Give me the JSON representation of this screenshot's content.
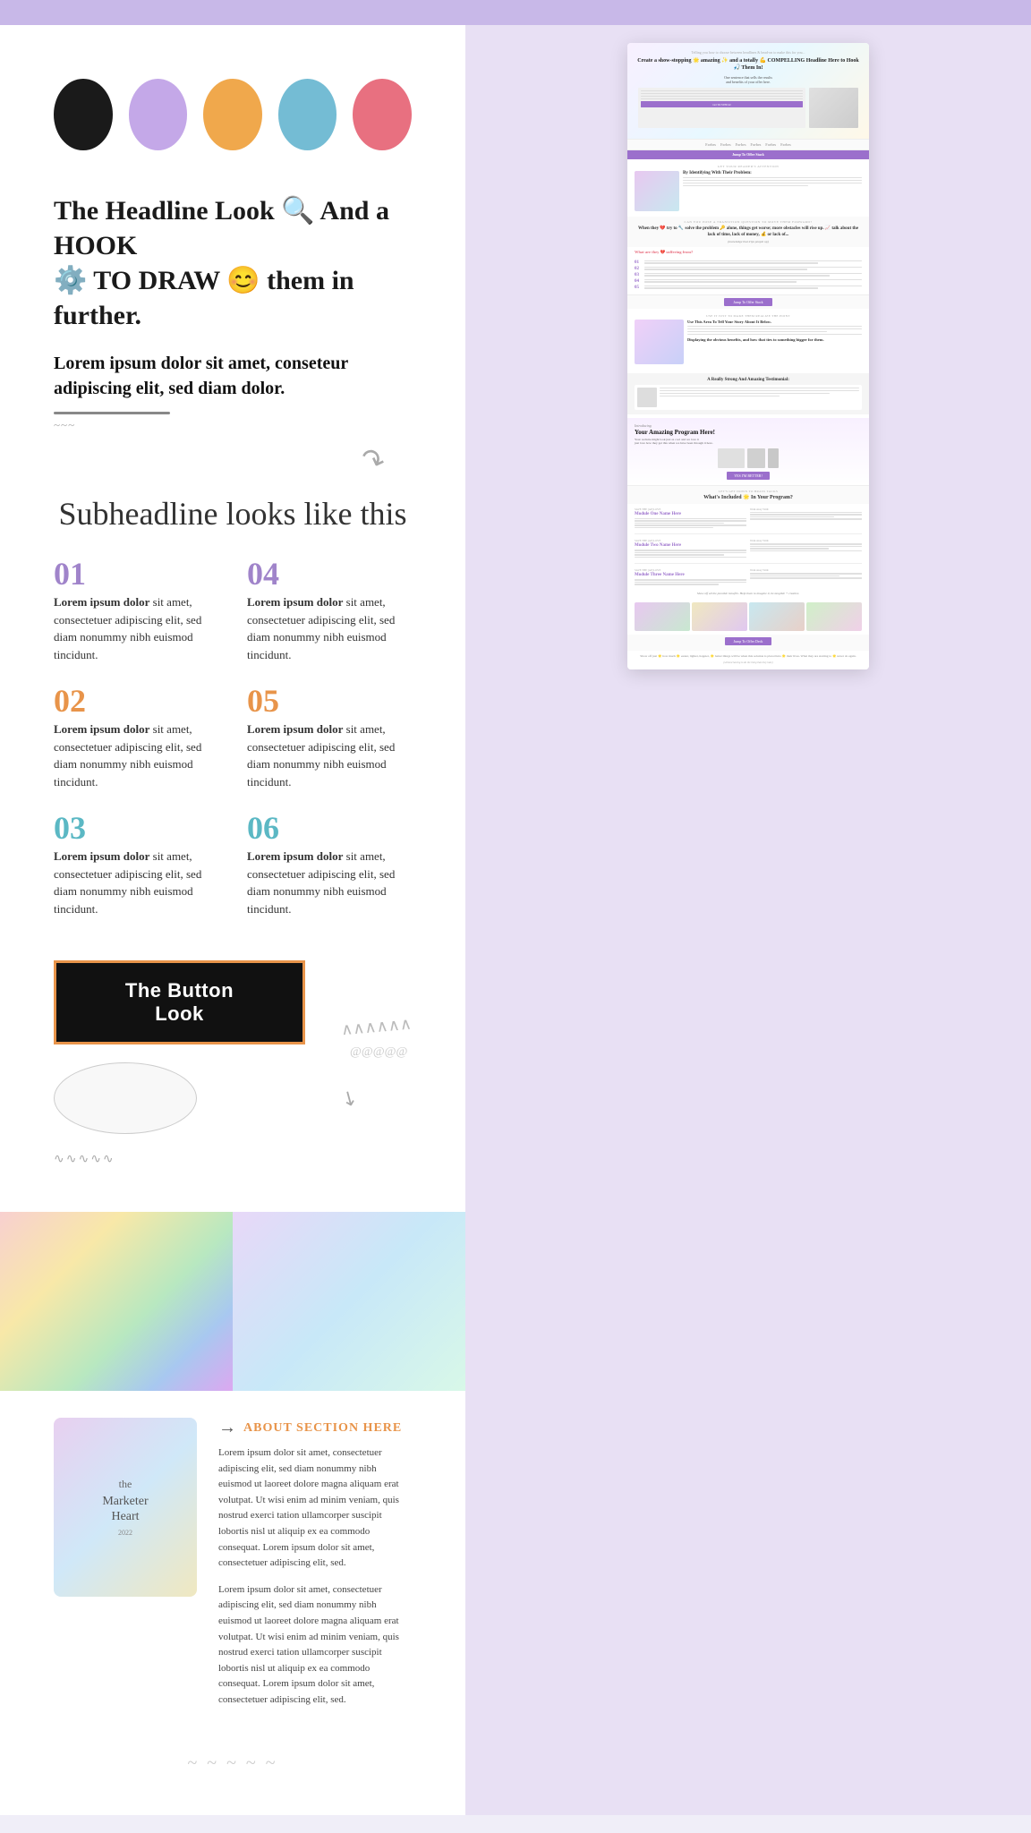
{
  "topBar": {
    "background": "#c8b8e8"
  },
  "colorSwatches": [
    {
      "color": "#1a1a1a",
      "label": "black"
    },
    {
      "color": "#c4a8e8",
      "label": "lavender"
    },
    {
      "color": "#f0a84c",
      "label": "orange"
    },
    {
      "color": "#74bcd4",
      "label": "teal"
    },
    {
      "color": "#e87080",
      "label": "pink"
    }
  ],
  "headline": {
    "text": "The Headline Look 🔍 And a HOOK ⚙️ TO DRAW 😊 them in further.",
    "subtext": "Lorem ipsum dolor sit amet, conseteur adipiscing elit, sed diam dolor.",
    "subheadline": "Subheadline looks like this"
  },
  "listItems": [
    {
      "number": "01",
      "color": "purple",
      "bold": "Lorem ipsum dolor",
      "text": "sit amet, consectetuer adipiscing elit, sed diam nonummy nibh euismod tincidunt."
    },
    {
      "number": "04",
      "color": "purple",
      "bold": "Lorem ipsum dolor",
      "text": "sit amet, consectetuer adipiscing elit, sed diam nonummy nibh euismod tincidunt."
    },
    {
      "number": "02",
      "color": "orange",
      "bold": "Lorem ipsum dolor",
      "text": "sit amet, consectetuer adipiscing elit, sed diam nonummy nibh euismod tincidunt."
    },
    {
      "number": "05",
      "color": "orange",
      "bold": "Lorem ipsum dolor",
      "text": "sit amet, consectetuer adipiscing elit, sed diam nonummy nibh euismod tincidunt."
    },
    {
      "number": "03",
      "color": "teal",
      "bold": "Lorem ipsum dolor",
      "text": "sit amet, consectetuer adipiscing elit, sed diam nonummy nibh euismod tincidunt."
    },
    {
      "number": "06",
      "color": "teal",
      "bold": "Lorem ipsum dolor",
      "text": "sit amet, consectetuer adipiscing elit, sed diam nonummy nibh euismod tincidunt."
    }
  ],
  "button": {
    "label": "The Button Look"
  },
  "aboutSection": {
    "label": "ABOUT SECTION HERE",
    "arrow": "→",
    "paragraph1": "Lorem ipsum dolor sit amet, consectetuer adipiscing elit, sed diam nonummy nibh euismod ut laoreet dolore magna aliquam erat volutpat. Ut wisi enim ad minim veniam, quis nostrud exerci tation ullamcorper suscipit lobortis nisl ut aliquip ex ea commodo consequat. Lorem ipsum dolor sit amet, consectetuer adipiscing elit, sed.",
    "paragraph2": "Lorem ipsum dolor sit amet, consectetuer adipiscing elit, sed diam nonummy nibh euismod ut laoreet dolore magna aliquam erat volutpat. Ut wisi enim ad minim veniam, quis nostrud exerci tation ullamcorper suscipit lobortis nisl ut aliquip ex ea commodo consequat. Lorem ipsum dolor sit amet, consectetuer adipiscing elit, sed."
  },
  "miniWebsite": {
    "topText": "Telling you how to choose between headlines & head-on to make this for you...",
    "heroHeadline": "Create a show-stopping 🌟 amazing ✨ and a totally 💪 COMPELLING Headline Here to Hook 🎣 Them In!",
    "heroSub": "One sentence that sells the results and benefits of your offer here.",
    "ctaButton": "GO TO STEP #2",
    "jumpButton": "Jump To Offer Stack",
    "logos": [
      "Forbes",
      "Forbes",
      "Forbes",
      "Forbes",
      "Forbes",
      "Forbes"
    ],
    "problemHeader": "GET YOUR READERS ATTENTION",
    "problemTitle": "By Identifying With Their Problem:",
    "problemText": "Find a real quote? Lorem back all at what somebody is dealing with, a thing Effective, Lorem ipsum dolor sit amet, consectetuer adipiscing elit...",
    "questionHeader": "CAN YOU POSE A TRANSITION QUESTION TO MOVE THEM FORWARD?",
    "agitateHeader": "What are they 💔 suffering from?",
    "moduleHeader": "What's Included 🌟 In Your Program?",
    "modules": [
      {
        "name": "Module One Name Here",
        "label": "SAVE THE [AP] LOVE"
      },
      {
        "name": "Module Two Name Here",
        "label": "SAVE THE [AP] LOVE"
      },
      {
        "name": "Module Three Name Here",
        "label": "SAVE THE [AP] LOVE"
      }
    ],
    "offerButton": "Jump To Offer Stack",
    "testButton": "Jump To Offer Deck",
    "programTitle": "Introducing",
    "programName": "Your Amazing Program Here!",
    "programSub": "Your website might look just as cool and we love it"
  }
}
